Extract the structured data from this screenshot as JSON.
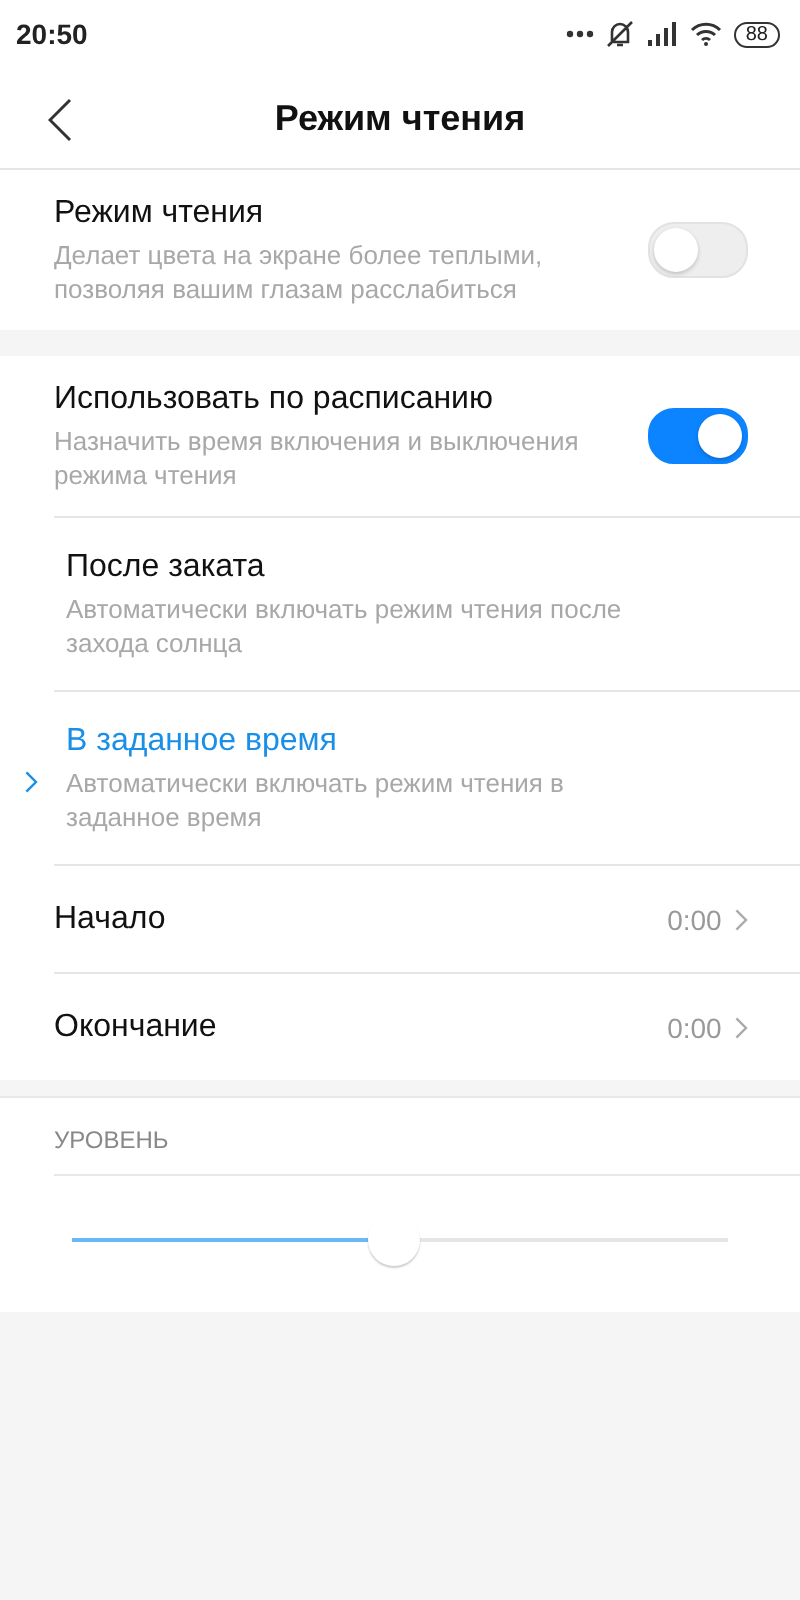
{
  "status_bar": {
    "time": "20:50",
    "battery": "88"
  },
  "header": {
    "title": "Режим чтения"
  },
  "sections": [
    {
      "items": [
        {
          "kind": "toggle",
          "title": "Режим чтения",
          "subtitle": "Делает цвета на экране более теплыми, позволяя вашим глазам расслабиться",
          "on": false
        }
      ]
    },
    {
      "items": [
        {
          "kind": "toggle",
          "title": "Использовать по расписанию",
          "subtitle": "Назначить время включения и выключения режима чтения",
          "on": true
        },
        {
          "kind": "choice",
          "title": "После заката",
          "subtitle": "Автоматически включать режим чтения после захода солнца",
          "selected": false
        },
        {
          "kind": "choice",
          "title": "В заданное время",
          "subtitle": "Автоматически включать режим чтения в заданное время",
          "selected": true
        },
        {
          "kind": "time",
          "title": "Начало",
          "value": "0:00"
        },
        {
          "kind": "time",
          "title": "Окончание",
          "value": "0:00"
        }
      ]
    }
  ],
  "level_section": {
    "label": "УРОВЕНЬ",
    "level": 0.49
  }
}
